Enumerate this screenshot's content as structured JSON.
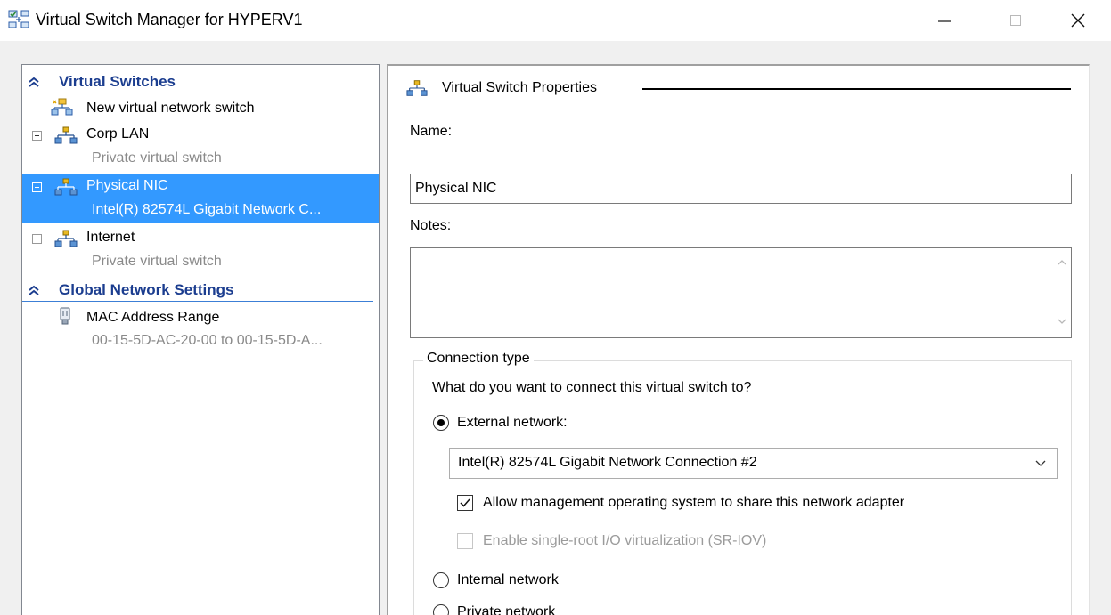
{
  "window": {
    "title": "Virtual Switch Manager for HYPERV1",
    "app_icon": "virtual-switch-manager-icon",
    "controls": [
      "minimize-icon",
      "maximize-icon",
      "close-icon"
    ]
  },
  "tree": {
    "sections": [
      {
        "label": "Virtual Switches",
        "icon": "collapse-chevron-icon",
        "items": [
          {
            "primary": "New virtual network switch",
            "icon": "new-switch-icon",
            "expandable": false
          },
          {
            "primary": "Corp LAN",
            "secondary": "Private virtual switch",
            "icon": "network-switch-icon",
            "expandable": true
          },
          {
            "primary": "Physical NIC",
            "secondary": "Intel(R) 82574L Gigabit Network C...",
            "icon": "network-switch-icon",
            "expandable": true,
            "selected": true
          },
          {
            "primary": "Internet",
            "secondary": "Private virtual switch",
            "icon": "network-switch-icon",
            "expandable": true
          }
        ]
      },
      {
        "label": "Global Network Settings",
        "icon": "collapse-chevron-icon",
        "items": [
          {
            "primary": "MAC Address Range",
            "secondary": "00-15-5D-AC-20-00 to 00-15-5D-A...",
            "icon": "mac-address-icon",
            "expandable": false
          }
        ]
      }
    ]
  },
  "properties": {
    "group_title": "Virtual Switch Properties",
    "name_label": "Name:",
    "name_value": "Physical NIC",
    "notes_label": "Notes:",
    "notes_value": "",
    "connection": {
      "legend": "Connection type",
      "question": "What do you want to connect this virtual switch to?",
      "external_label": "External network:",
      "external_selected": true,
      "adapter_value": "Intel(R) 82574L Gigabit Network Connection #2",
      "allow_mgmt_label": "Allow management operating system to share this network adapter",
      "allow_mgmt_checked": true,
      "sriov_label": "Enable single-root I/O virtualization (SR-IOV)",
      "sriov_checked": false,
      "sriov_enabled": false,
      "internal_label": "Internal network",
      "internal_selected": false,
      "private_label": "Private network",
      "private_selected": false
    }
  },
  "colors": {
    "selection": "#3399ff",
    "section_heading": "#1b3d8f",
    "section_rule": "#3c7fd6",
    "secondary_text": "#8a8a8a",
    "disabled_text": "#9b9b9b",
    "client_bg": "#f0f0f0"
  }
}
